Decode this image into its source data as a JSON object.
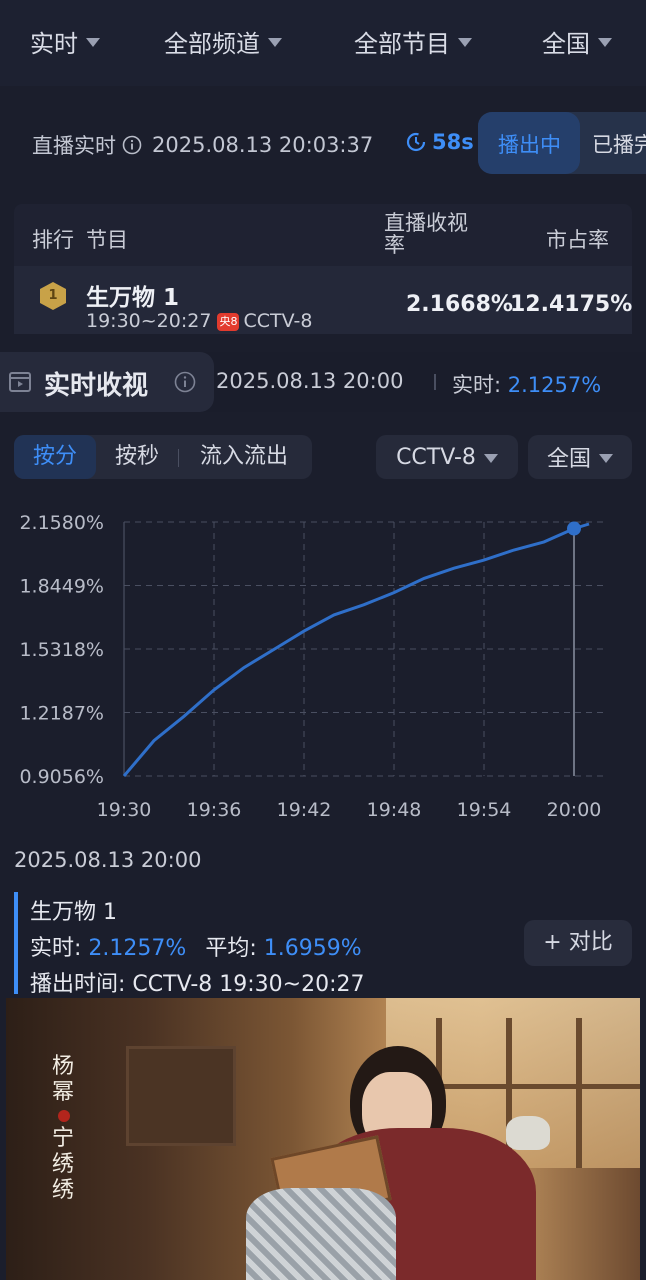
{
  "filters": [
    {
      "label": "实时"
    },
    {
      "label": "全部频道"
    },
    {
      "label": "全部节目"
    },
    {
      "label": "全国"
    }
  ],
  "live": {
    "prefix": "直播实时",
    "datetime": "2025.08.13 20:03:37",
    "countdown": "58s",
    "seg_on": "播出中",
    "seg_off": "已播完"
  },
  "table": {
    "col_rank": "排行",
    "col_program": "节目",
    "col_rating_line1": "直播收视",
    "col_rating_line2": "率",
    "col_share": "市占率",
    "rows": [
      {
        "rank": "1",
        "title": "生万物 1",
        "time": "19:30~20:27",
        "channel_logo": "央8",
        "channel": "CCTV-8",
        "rating": "2.1668%",
        "share": "12.4175%"
      }
    ]
  },
  "realtime": {
    "title": "实时收视",
    "datetime": "2025.08.13 20:00",
    "current_label": "实时:",
    "current_value": "2.1257%",
    "tabs": [
      "按分",
      "按秒",
      "流入流出"
    ],
    "channel_select": "CCTV-8",
    "region_select": "全国"
  },
  "chart_data": {
    "type": "line",
    "x": [
      "19:30",
      "19:32",
      "19:34",
      "19:36",
      "19:38",
      "19:40",
      "19:42",
      "19:44",
      "19:46",
      "19:48",
      "19:50",
      "19:52",
      "19:54",
      "19:56",
      "19:58",
      "20:00",
      "20:01"
    ],
    "values": [
      0.9056,
      1.08,
      1.2,
      1.33,
      1.44,
      1.53,
      1.62,
      1.7,
      1.75,
      1.81,
      1.88,
      1.93,
      1.97,
      2.02,
      2.06,
      2.1257,
      2.148
    ],
    "yticks": [
      "0.9056%",
      "1.2187%",
      "1.5318%",
      "1.8449%",
      "2.1580%"
    ],
    "xticks": [
      "19:30",
      "19:36",
      "19:42",
      "19:48",
      "19:54",
      "20:00"
    ],
    "ylim": [
      0.9056,
      2.158
    ],
    "grid": true,
    "highlight_x": "20:00",
    "line_color": "#2f6fc9"
  },
  "detail": {
    "datetime": "2025.08.13 20:00",
    "program": "生万物 1",
    "current_label": "实时:",
    "current_value": "2.1257%",
    "avg_label": "平均:",
    "avg_value": "1.6959%",
    "airtime_label": "播出时间:",
    "airtime_value": "CCTV-8 19:30~20:27",
    "compare_button": "+ 对比"
  },
  "poster": {
    "vertical_text_1": "杨幂",
    "vertical_text_2": "宁绣绣"
  }
}
